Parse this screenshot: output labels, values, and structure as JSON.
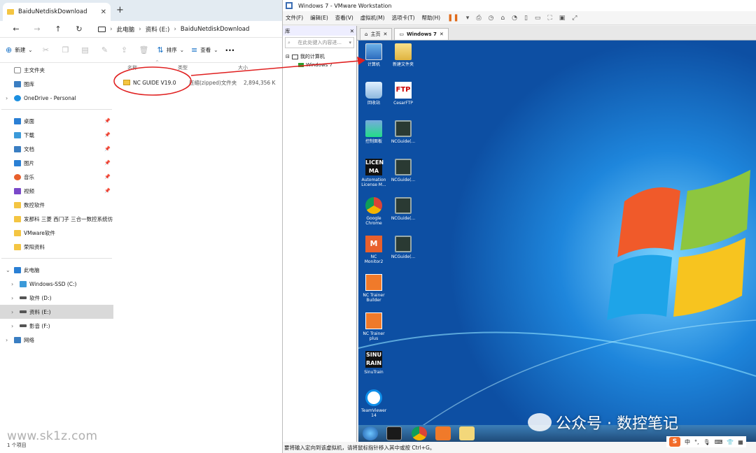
{
  "explorer": {
    "tab_title": "BaiduNetdiskDownload",
    "tab_close": "✕",
    "tab_plus": "+",
    "breadcrumb": [
      "此电脑",
      "资料 (E:)",
      "BaiduNetdiskDownload"
    ],
    "toolbar": {
      "new_label": "新建",
      "sort_label": "排序",
      "view_label": "查看",
      "more": "···"
    },
    "nav": {
      "home": "主文件夹",
      "gallery": "图库",
      "onedrive": "OneDrive - Personal",
      "quick": [
        {
          "label": "桌面",
          "icon": "desktop-icon"
        },
        {
          "label": "下载",
          "icon": "download-icon"
        },
        {
          "label": "文档",
          "icon": "document-icon"
        },
        {
          "label": "图片",
          "icon": "pictures-icon"
        },
        {
          "label": "音乐",
          "icon": "music-icon"
        },
        {
          "label": "视频",
          "icon": "video-icon"
        }
      ],
      "folders": [
        "数控软件",
        "发那科 三菱 西门子 三合一数控系统仿",
        "VMware软件",
        "荣阳资料"
      ],
      "this_pc": "此电脑",
      "drives": [
        "Windows-SSD (C:)",
        "软件 (D:)",
        "资料 (E:)",
        "影音 (F:)"
      ],
      "network": "网络"
    },
    "columns": {
      "name": "名称",
      "type": "类型",
      "size": "大小"
    },
    "file": {
      "name": "NC GUIDE V19.0",
      "type": "压缩(zipped)文件夹",
      "size": "2,894,356 K"
    },
    "status": "1 个项目",
    "watermark": "www.sk1z.com"
  },
  "vmware": {
    "title": "Windows 7 - VMware Workstation",
    "menu": [
      "文件(F)",
      "编辑(E)",
      "查看(V)",
      "虚拟机(M)",
      "选项卡(T)",
      "帮助(H)"
    ],
    "library_title": "库",
    "library_close": "✕",
    "search_placeholder": "在此处键入内容进...",
    "tree_root": "我的计算机",
    "tree_vm": "Windows 7",
    "tabs": [
      {
        "label": "主页",
        "icon": "home-icon"
      },
      {
        "label": "Windows 7",
        "icon": "vm-icon"
      }
    ],
    "status": "要将输入定向到该虚拟机，请将鼠标指针移入其中或按 Ctrl+G。"
  },
  "desktop_icons": [
    {
      "label": "计算机",
      "kind": "comp"
    },
    {
      "label": "新建文件夹",
      "kind": "fold"
    },
    {
      "label": "回收站",
      "kind": "bin"
    },
    {
      "label": "CesarFTP",
      "kind": "ftp",
      "glyph": "FTP"
    },
    {
      "label": "控制面板",
      "kind": "ctl"
    },
    {
      "label": "NCGuide(...",
      "kind": "nc"
    },
    {
      "label": "Automation License M...",
      "kind": "lic",
      "glyph": "LICEN MA"
    },
    {
      "label": "NCGuide(...",
      "kind": "nc"
    },
    {
      "label": "Google Chrome",
      "kind": "chr"
    },
    {
      "label": "NCGuide(...",
      "kind": "nc"
    },
    {
      "label": "NC Monitor2",
      "kind": "ncm",
      "glyph": "M"
    },
    {
      "label": "NCGuide(...",
      "kind": "nc"
    },
    {
      "label": "NC Trainer Builder",
      "kind": "nct"
    },
    {
      "label": "NC Trainer plus",
      "kind": "nct"
    },
    {
      "label": "SinuTrain",
      "kind": "sin",
      "glyph": "SINU RAIN"
    },
    {
      "label": "TeamViewer 14",
      "kind": "tv"
    }
  ],
  "overlay_text": "公众号 · 数控笔记",
  "ime": {
    "logo": "S",
    "mode": "中"
  },
  "colors": {
    "desktop_blue": "#1569c7",
    "annotation_red": "#e02020"
  }
}
